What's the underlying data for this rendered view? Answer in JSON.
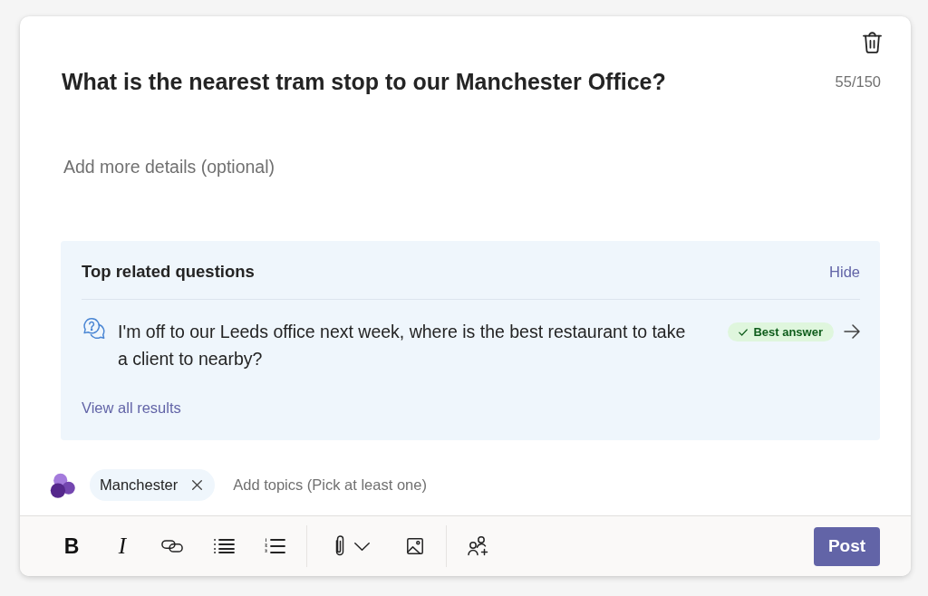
{
  "question": {
    "title": "What is the nearest tram stop to our Manchester Office?",
    "char_count": "55/150",
    "details_placeholder": "Add more details (optional)"
  },
  "related": {
    "heading": "Top related questions",
    "hide_link": "Hide",
    "items": [
      {
        "text": "I'm off to our Leeds office next week, where is the best restaurant to take a client to nearby?",
        "badge": "Best answer"
      }
    ],
    "view_all_link": "View all results"
  },
  "topics": {
    "chips": [
      {
        "label": "Manchester"
      }
    ],
    "placeholder": "Add topics (Pick at least one)"
  },
  "toolbar": {
    "bold": "B",
    "italic": "I"
  },
  "post_button": "Post"
}
